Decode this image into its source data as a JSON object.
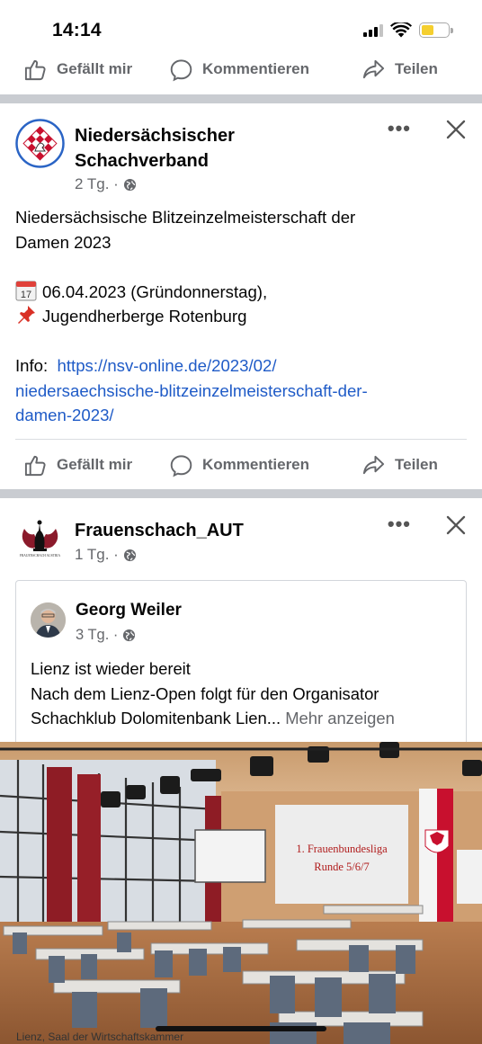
{
  "status": {
    "time": "14:14"
  },
  "actions": {
    "like": "Gefällt mir",
    "comment": "Kommentieren",
    "share": "Teilen"
  },
  "post1": {
    "author_line1": "Niedersächsischer",
    "author_line2": "Schachverband",
    "time": "2 Tg. ·",
    "line1": "Niedersächsische Blitzeinzelmeisterschaft der",
    "line2": "Damen 2023",
    "date_line": "06.04.2023 (Gründonnerstag),",
    "place_line": "Jugendherberge Rotenburg",
    "info_label": "Info:",
    "link_line1": "https://nsv-online.de/2023/02/",
    "link_line2": "niedersaechsische-blitzeinzelmeisterschaft-der-",
    "link_line3": "damen-2023/",
    "calendar_day": "17"
  },
  "post2": {
    "author": "Frauenschach_AUT",
    "time": "1 Tg. ·",
    "logo_text": "FRAUENSCHACH AUSTRIA",
    "shared": {
      "author": "Georg Weiler",
      "time": "3 Tg. ·",
      "line1": "Lienz ist wieder bereit",
      "line2": "Nach dem Lienz-Open folgt für den Organisator",
      "line3": "Schachklub Dolomitenbank Lien...",
      "see_more": "Mehr anzeigen"
    },
    "photo": {
      "screen_line1": "1. Frauenbundesliga",
      "screen_line2": "Runde 5/6/7",
      "caption": "Lienz, Saal der Wirtschaftskammer"
    }
  }
}
